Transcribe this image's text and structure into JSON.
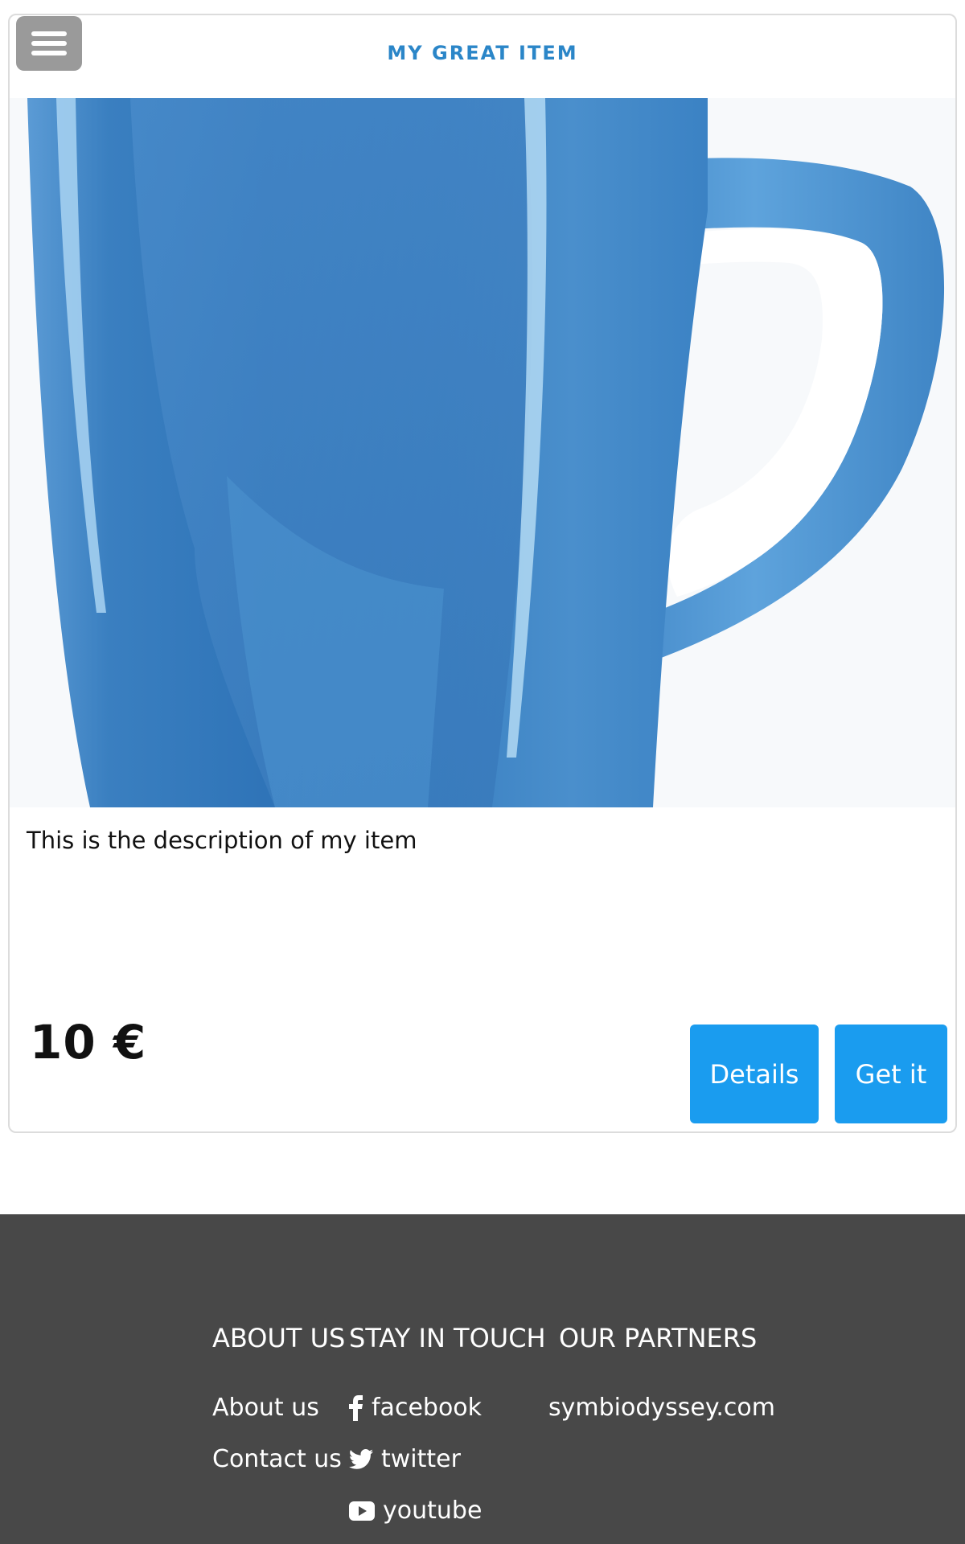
{
  "header": {
    "menu_icon": "hamburger-menu-icon",
    "title": "MY GREAT ITEM"
  },
  "item": {
    "image": "blue-mug-photo",
    "description": "This is the description of my item",
    "price": "10 €",
    "details_label": "Details",
    "get_label": "Get it"
  },
  "footer": {
    "about": {
      "heading": "ABOUT US",
      "links": [
        "About us",
        "Contact us"
      ]
    },
    "social": {
      "heading": "STAY IN TOUCH",
      "links": [
        {
          "label": "facebook",
          "icon": "facebook-icon"
        },
        {
          "label": "twitter",
          "icon": "twitter-icon"
        },
        {
          "label": "youtube",
          "icon": "youtube-icon"
        }
      ]
    },
    "partners": {
      "heading": "OUR PARTNERS",
      "links": [
        "symbiodyssey.com"
      ]
    }
  },
  "colors": {
    "accent": "#1a9cef",
    "title": "#2b86c8",
    "footer_bg": "#484848",
    "mug": "#3f86c6"
  }
}
